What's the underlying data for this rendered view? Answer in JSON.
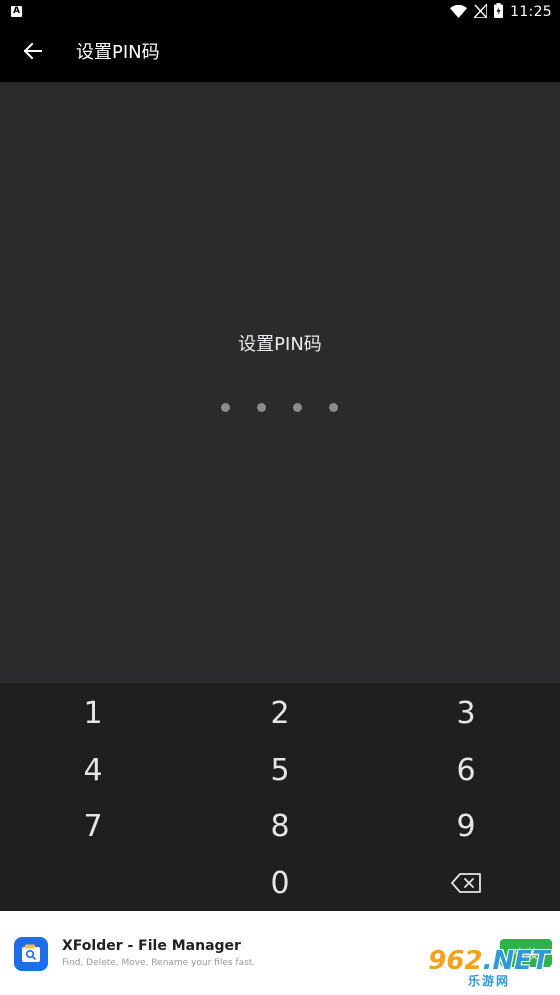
{
  "status_bar": {
    "notification_badge": "A",
    "time": "11:25"
  },
  "app_bar": {
    "title": "设置PIN码"
  },
  "pin": {
    "prompt": "设置PIN码",
    "length": 4,
    "entered": 0
  },
  "keypad": {
    "keys": [
      "1",
      "2",
      "3",
      "4",
      "5",
      "6",
      "7",
      "8",
      "9",
      "0"
    ]
  },
  "ad": {
    "title": "XFolder - File Manager",
    "subtitle": "Find, Delete, Move, Rename your files fast.",
    "install_label": "安装",
    "brand_color": "#1e6fe3",
    "install_color": "#2cb34a"
  },
  "watermark": {
    "main_digits": "962",
    "main_suffix": ".NET",
    "sub": "乐游网"
  }
}
